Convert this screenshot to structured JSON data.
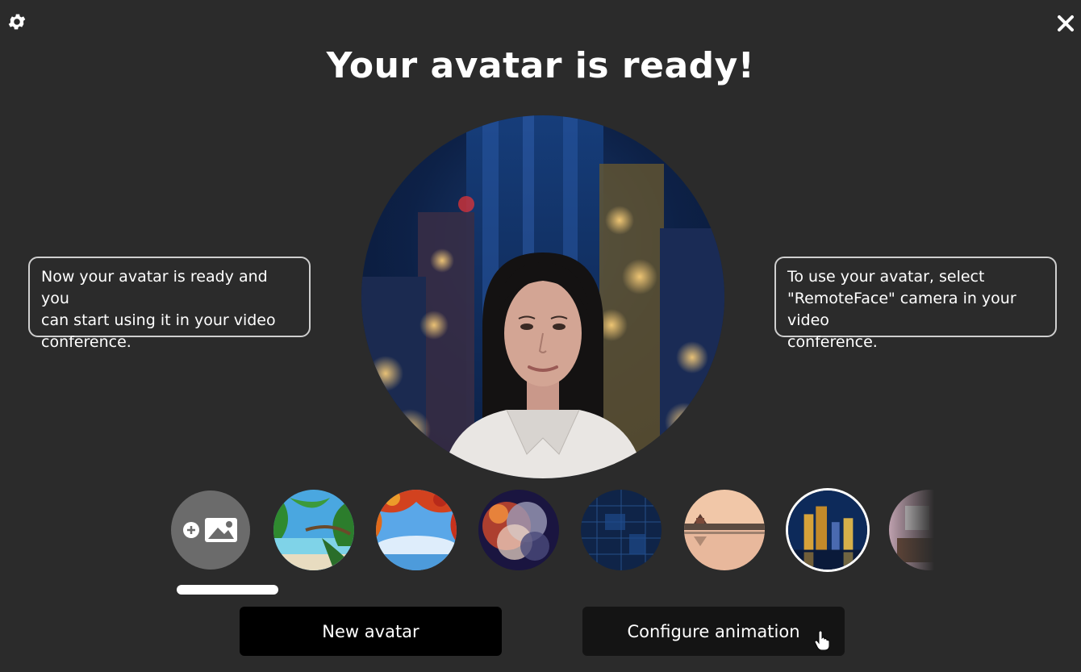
{
  "title": "Your avatar is ready!",
  "left_info": [
    "Now your avatar is ready and you",
    "can start using it in your video",
    "conference."
  ],
  "right_info": [
    "To use your avatar, select",
    "\"RemoteFace\" camera in your video",
    "conference."
  ],
  "buttons": {
    "new_avatar": "New avatar",
    "configure_animation": "Configure animation"
  },
  "backgrounds": [
    {
      "name": "tropical-beach",
      "selected": false
    },
    {
      "name": "autumn-leaves-sky",
      "selected": false
    },
    {
      "name": "nebula",
      "selected": false
    },
    {
      "name": "blue-tech-grid",
      "selected": false
    },
    {
      "name": "forbidden-city-reflection",
      "selected": false
    },
    {
      "name": "night-city-skyline",
      "selected": true
    },
    {
      "name": "interior-room",
      "selected": false
    }
  ],
  "icons": {
    "settings": "gear-icon",
    "close": "close-icon",
    "add_background": "add-image-icon"
  }
}
